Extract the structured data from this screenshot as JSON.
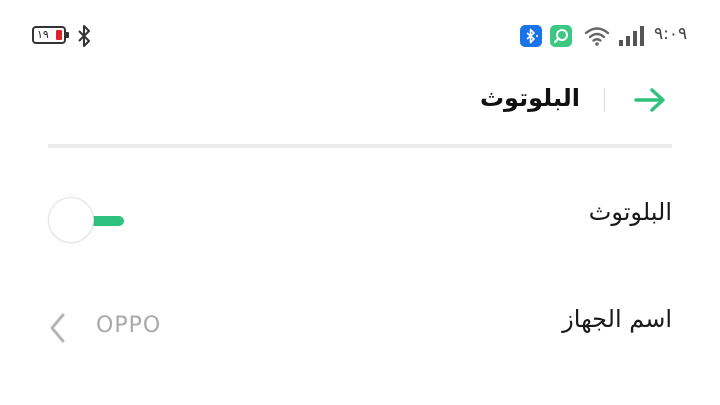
{
  "status_bar": {
    "battery_level": "١٩",
    "time": "٩:٠٩",
    "colors": {
      "battery_low": "#e0222a",
      "bluetooth_badge": "#1b73e8",
      "app_badge": "#3cc882"
    },
    "icons": [
      "bluetooth-icon",
      "bluetooth-notification-icon",
      "app-notification-icon",
      "wifi-icon",
      "signal-icon"
    ]
  },
  "header": {
    "title": "البلوتوث",
    "back_icon": "arrow-right-icon",
    "accent_color": "#2ec27e"
  },
  "settings": {
    "bluetooth": {
      "label": "البلوتوث",
      "enabled": false
    },
    "device_name": {
      "label": "اسم الجهاز",
      "value": "OPPO",
      "icon": "chevron-left-icon"
    }
  }
}
